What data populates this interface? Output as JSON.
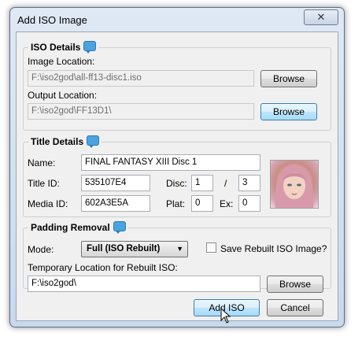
{
  "window": {
    "title": "Add ISO Image",
    "close_glyph": "✕"
  },
  "iso_details": {
    "title": "ISO Details",
    "image_location_label": "Image Location:",
    "image_location_value": "F:\\iso2god\\all-ff13-disc1.iso",
    "output_location_label": "Output Location:",
    "output_location_value": "F:\\iso2god\\FF13D1\\",
    "browse_label": "Browse"
  },
  "title_details": {
    "title": "Title Details",
    "name_label": "Name:",
    "name_value": "FINAL FANTASY XIII Disc 1",
    "title_id_label": "Title ID:",
    "title_id_value": "535107E4",
    "disc_label": "Disc:",
    "disc_value": "1",
    "disc_separator": "/",
    "disc_total_value": "3",
    "media_id_label": "Media ID:",
    "media_id_value": "602A3E5A",
    "plat_label": "Plat:",
    "plat_value": "0",
    "ex_label": "Ex:",
    "ex_value": "0",
    "boxart_icon": "character-portrait-icon"
  },
  "padding_removal": {
    "title": "Padding Removal",
    "mode_label": "Mode:",
    "mode_value": "Full (ISO Rebuilt)",
    "save_rebuilt_label": "Save Rebuilt ISO Image?",
    "save_rebuilt_checked": false,
    "temp_location_label": "Temporary Location for Rebuilt ISO:",
    "temp_location_value": "F:\\iso2god\\",
    "browse_label": "Browse"
  },
  "footer": {
    "add_label": "Add ISO",
    "cancel_label": "Cancel"
  },
  "colors": {
    "accent": "#3c7fb1",
    "frame": "#c9d9ec",
    "info_icon": "#4aa3df"
  }
}
